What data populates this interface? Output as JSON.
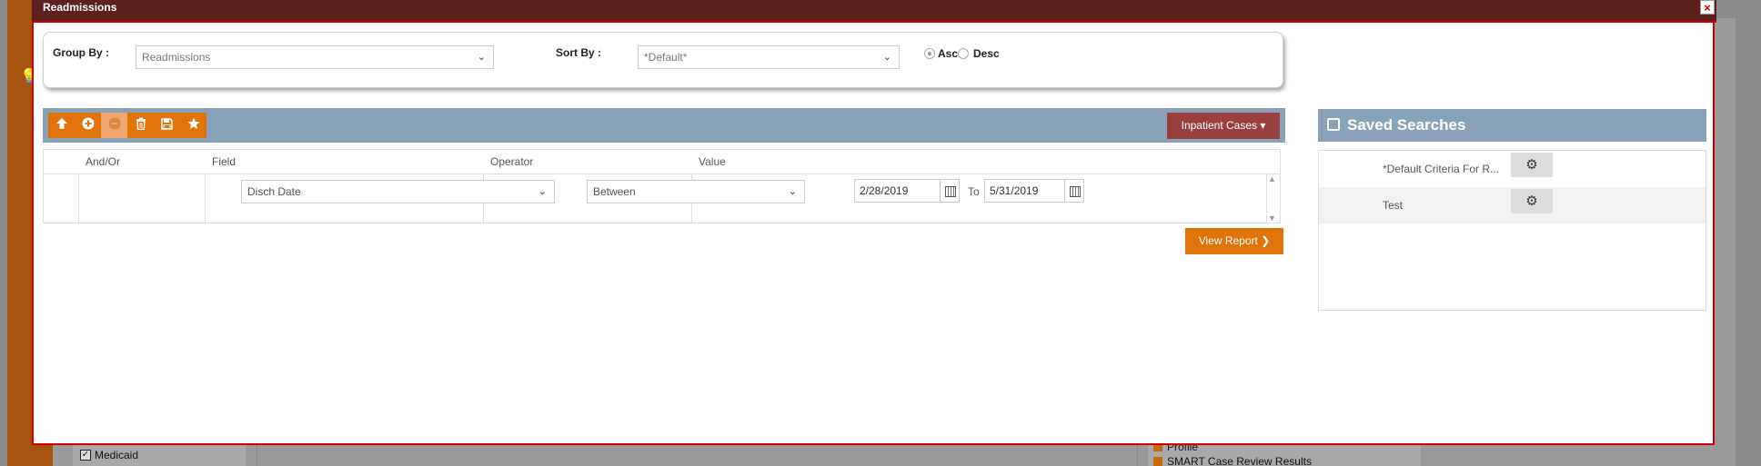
{
  "modal": {
    "title": "Readmissions",
    "close_glyph": "×"
  },
  "options": {
    "group_by_label": "Group By :",
    "group_by_value": "Readmissions",
    "sort_by_label": "Sort By :",
    "sort_by_value": "*Default*",
    "asc_label": "Asc",
    "desc_label": "Desc",
    "selected_order": "Asc"
  },
  "toolbar": {
    "icons": [
      "arrow-up-icon",
      "plus-circle-icon",
      "minus-circle-icon",
      "trash-icon",
      "save-icon",
      "star-icon"
    ],
    "dropdown_label": "Inpatient Cases ▾"
  },
  "criteria": {
    "columns": [
      "And/Or",
      "Field",
      "Operator",
      "Value"
    ],
    "rows": [
      {
        "and_or": "",
        "field": "Disch Date",
        "operator": "Between",
        "value_from": "2/28/2019",
        "to_label": "To",
        "value_to": "5/31/2019"
      }
    ]
  },
  "view_report_label": "View Report ❯",
  "saved_searches": {
    "title": "Saved Searches",
    "items": [
      {
        "name": "*Default Criteria For R..."
      },
      {
        "name": "Test"
      }
    ]
  },
  "background": {
    "checkbox_label": "Medicaid",
    "links": [
      "Profile",
      "SMART Case Review Results"
    ]
  },
  "colors": {
    "titlebar": "#5e1f1f",
    "accent_orange": "#e0740a",
    "panel_blue": "#8aa2b8",
    "dropdown_maroon": "#9a3f3f"
  }
}
